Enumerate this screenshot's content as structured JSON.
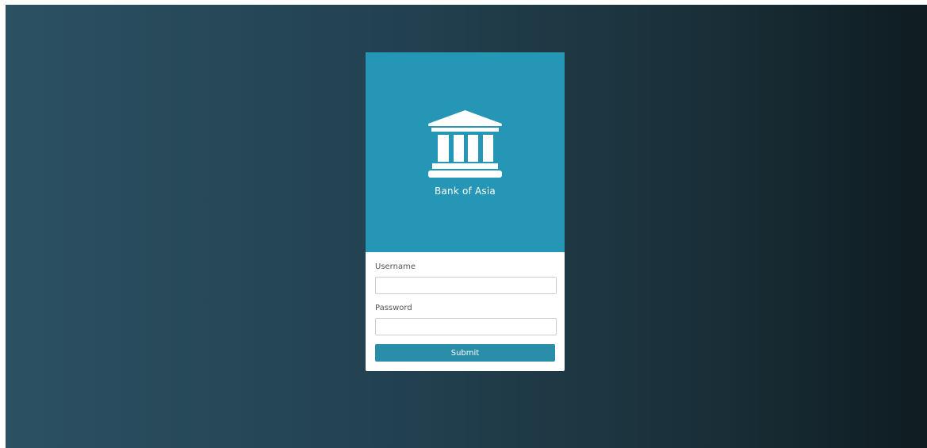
{
  "brand": {
    "name": "Bank of Asia",
    "icon": "bank-icon"
  },
  "form": {
    "username_label": "Username",
    "username_value": "",
    "password_label": "Password",
    "password_value": "",
    "submit_label": "Submit"
  },
  "colors": {
    "header": "#2596b5",
    "button": "#2a8daa",
    "background_left": "#2b5163",
    "background_right": "#0f1c22"
  }
}
